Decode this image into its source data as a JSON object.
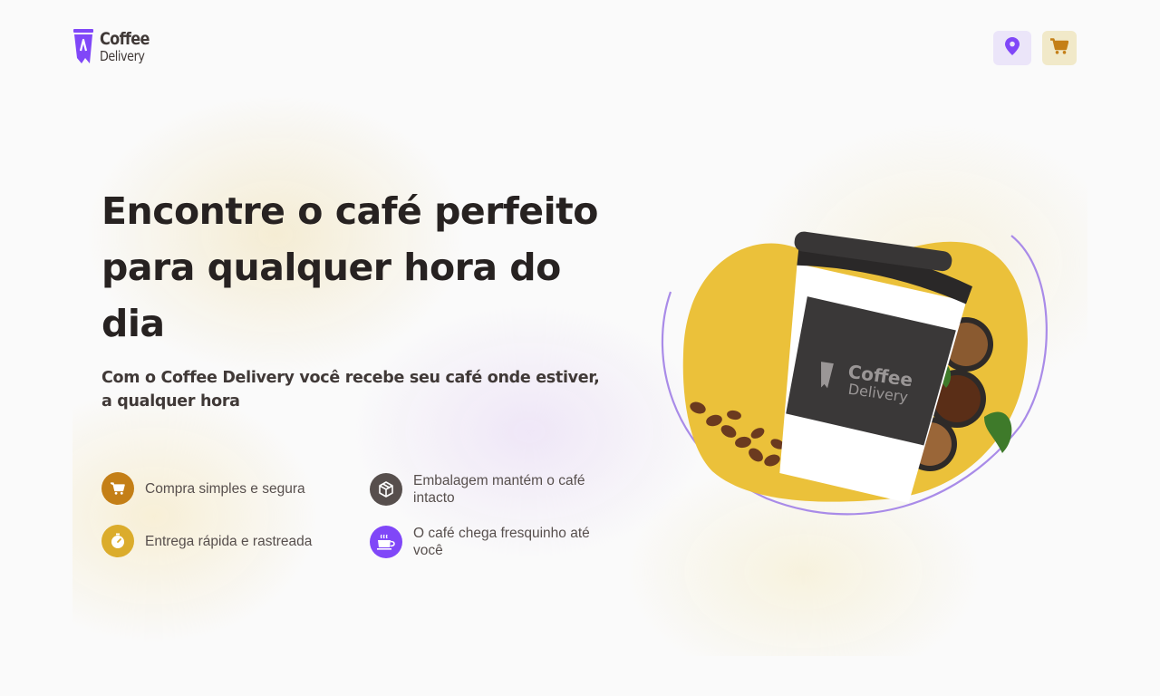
{
  "header": {
    "logo": {
      "line1": "Coffee",
      "line2": "Delivery",
      "icon": "coffee-cup-logo"
    },
    "location_button": {
      "icon": "map-pin-icon",
      "color": "#8047F8"
    },
    "cart_button": {
      "icon": "shopping-cart-icon",
      "color": "#C47F17"
    }
  },
  "hero": {
    "title": "Encontre o café perfeito para qualquer hora do dia",
    "subtitle": "Com o Coffee Delivery você recebe seu café onde estiver, a qualquer hora",
    "features": [
      {
        "label": "Compra simples e segura",
        "icon": "shopping-cart-icon",
        "color": "#C47F17"
      },
      {
        "label": "Embalagem mantém o café intacto",
        "icon": "package-icon",
        "color": "#574F4D"
      },
      {
        "label": "Entrega rápida e rastreada",
        "icon": "timer-icon",
        "color": "#DBAC2C"
      },
      {
        "label": "O café chega fresquinho até você",
        "icon": "coffee-icon",
        "color": "#8047F8"
      }
    ],
    "image": {
      "cup_brand_line1": "Coffee",
      "cup_brand_line2": "Delivery"
    }
  },
  "colors": {
    "background": "#FAFAFA",
    "purple": "#8047F8",
    "yellow": "#DBAC2C",
    "yellow_dark": "#C47F17",
    "text": "#272221"
  }
}
